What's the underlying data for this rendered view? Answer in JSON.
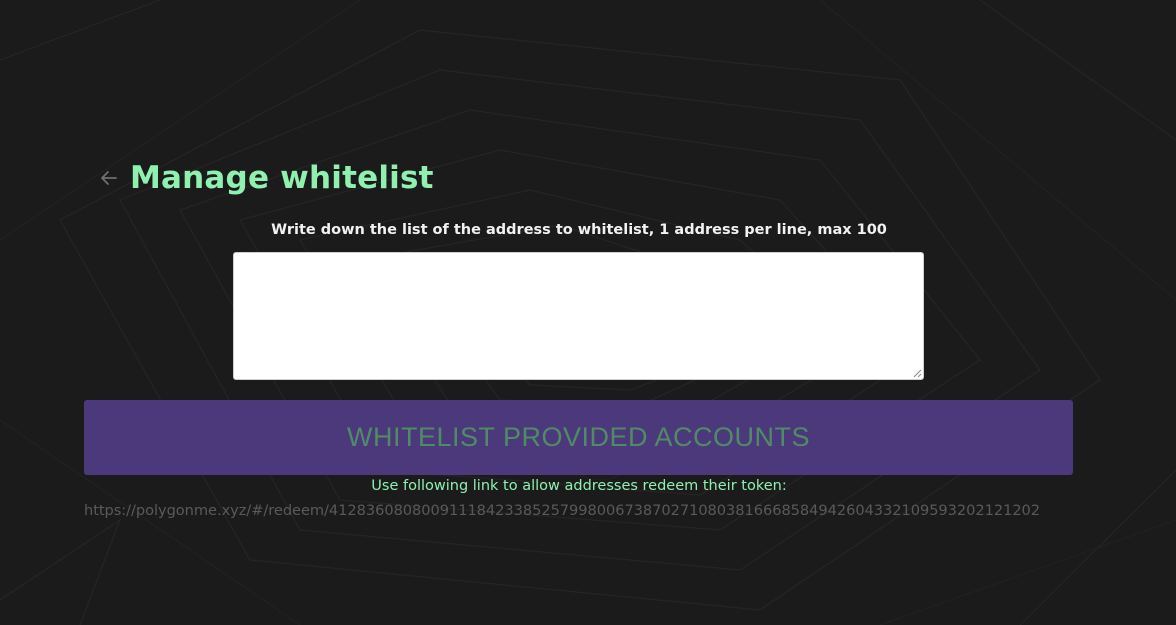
{
  "header": {
    "title": "Manage whitelist",
    "back_icon": "arrow-left-icon"
  },
  "form": {
    "instruction": "Write down the list of the address to whitelist, 1 address per line, max 100",
    "addresses_value": "",
    "submit_label": "WHITELIST PROVIDED ACCOUNTS"
  },
  "redeem": {
    "label": "Use following link to allow addresses redeem their token:",
    "url": "https://polygonme.xyz/#/redeem/41283608080091118423385257998006738702710803816668584942604332109593202121202"
  },
  "colors": {
    "background": "#1c1b1c",
    "accent_green": "#8ff0b0",
    "button_purple": "#4b397b",
    "button_text": "#4f8c66",
    "muted_url": "#5a5a5a"
  }
}
